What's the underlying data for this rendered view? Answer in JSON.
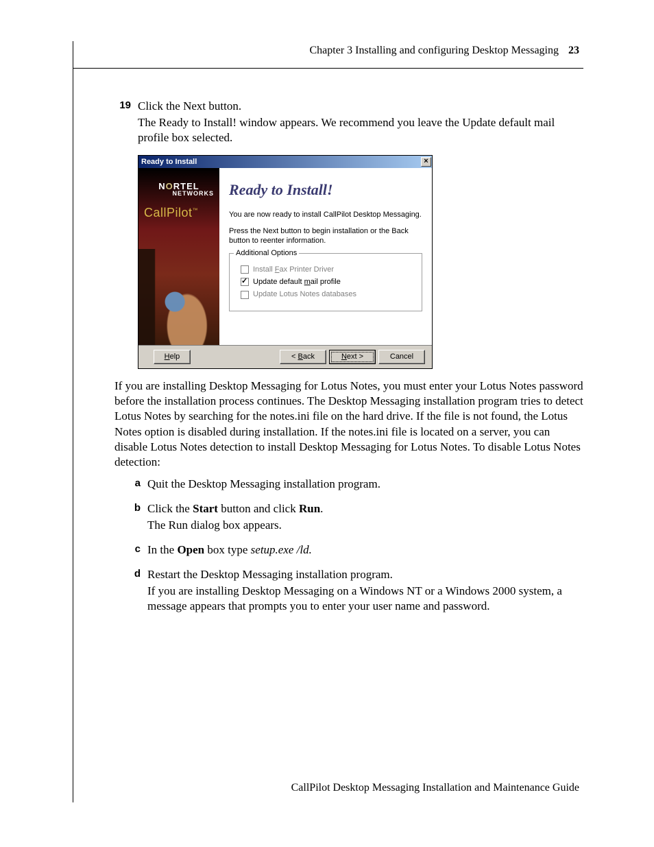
{
  "header": {
    "chapter": "Chapter 3   Installing and configuring Desktop Messaging",
    "page": "23"
  },
  "step19": {
    "num": "19",
    "line1": "Click the Next button.",
    "line2": "The Ready to Install! window appears. We recommend you leave the Update default mail profile box selected."
  },
  "dialog": {
    "title": "Ready to Install",
    "brand_top": "N",
    "brand_mid": "RTEL",
    "brand_o": "O",
    "brand_net": "NETWORKS",
    "callpilot": "CallPilot",
    "heading": "Ready to Install!",
    "p1": "You are now ready to install CallPilot Desktop Messaging.",
    "p2": "Press the Next button to begin installation or the Back button to reenter information.",
    "groupbox_legend": "Additional Options",
    "opt1_pre": "Install ",
    "opt1_ul": "F",
    "opt1_post": "ax Printer Driver",
    "opt2_pre": "Update default ",
    "opt2_ul": "m",
    "opt2_post": "ail profile",
    "opt3": "Update Lotus Notes databases",
    "btn_help_ul": "H",
    "btn_help_post": "elp",
    "btn_back_pre": "< ",
    "btn_back_ul": "B",
    "btn_back_post": "ack",
    "btn_next_ul": "N",
    "btn_next_post": "ext >",
    "btn_cancel": "Cancel",
    "close": "×"
  },
  "para1": "If you are installing Desktop Messaging for Lotus Notes, you must enter your Lotus Notes password before the installation process continues. The Desktop Messaging installation program tries to detect Lotus Notes by searching for the notes.ini file on the hard drive. If the file is not found, the Lotus Notes option is disabled during installation. If the notes.ini file is located on a server, you can disable Lotus Notes detection to install Desktop Messaging for Lotus Notes. To disable Lotus Notes detection:",
  "substeps": {
    "a": {
      "letter": "a",
      "text": "Quit the Desktop Messaging installation program."
    },
    "b": {
      "letter": "b",
      "pre": "Click the ",
      "bold1": "Start",
      "mid": " button and click ",
      "bold2": "Run",
      "post": ".",
      "line2": "The Run dialog box appears."
    },
    "c": {
      "letter": "c",
      "pre": "In the ",
      "bold1": "Open",
      "mid": " box type ",
      "ital": "setup.exe /ld.",
      "post": ""
    },
    "d": {
      "letter": "d",
      "line1": "Restart the Desktop Messaging installation program.",
      "line2": "If you are installing Desktop Messaging on a Windows NT or a Windows 2000 system, a message appears that prompts you to enter your user name and password."
    }
  },
  "footer": "CallPilot Desktop Messaging Installation and Maintenance Guide"
}
